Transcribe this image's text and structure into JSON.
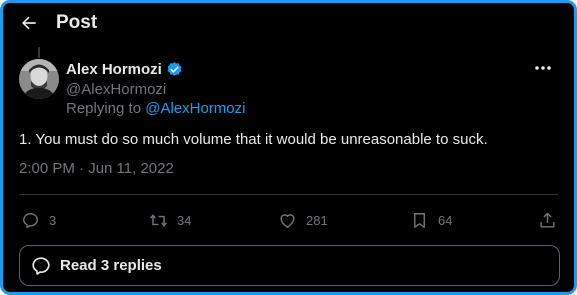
{
  "header": {
    "title": "Post",
    "back_icon": "arrow-left-icon"
  },
  "author": {
    "display_name": "Alex Hormozi",
    "handle": "@AlexHormozi",
    "verified": true,
    "verified_icon": "verified-badge-icon"
  },
  "replying_to": {
    "prefix": "Replying to ",
    "mention": "@AlexHormozi"
  },
  "tweet": {
    "text": "1. You must do so much volume that it would be unreasonable to suck.",
    "timestamp": "2:00 PM · Jun 11, 2022"
  },
  "actions": {
    "replies": "3",
    "retweets": "34",
    "likes": "281",
    "bookmarks": "64"
  },
  "replies_button": {
    "label": "Read 3 replies"
  },
  "colors": {
    "background": "#000000",
    "accent": "#1d9bf0",
    "text_primary": "#e7e9ea",
    "text_secondary": "#71767b",
    "border": "#2f3336"
  }
}
